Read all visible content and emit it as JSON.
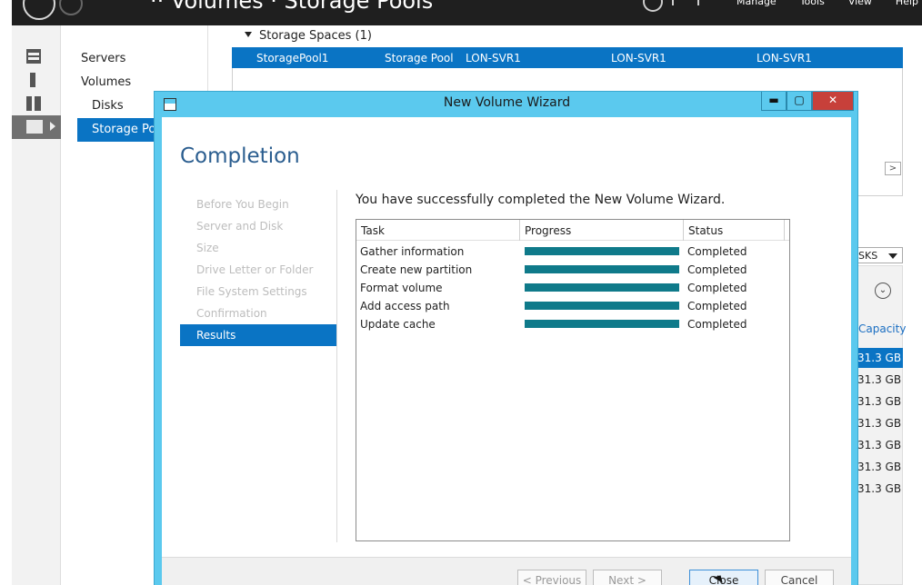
{
  "header": {
    "breadcrumb": "·· Volumes · Storage Pools",
    "menu": [
      "Manage",
      "Tools",
      "View",
      "Help"
    ]
  },
  "sidebar": {
    "items": [
      "Servers",
      "Volumes",
      "Disks",
      "Storage Pools"
    ]
  },
  "storage_spaces": {
    "header": "Storage Spaces (1)",
    "row": {
      "name": "StoragePool1",
      "type": "Storage Pool",
      "managed_by": "LON-SVR1",
      "available_to": "LON-SVR1",
      "read_write_server": "LON-SVR1"
    }
  },
  "disks_panel": {
    "dropdown_label": "SKS",
    "capacity_header": "Capacity",
    "capacities": [
      "31.3 GB",
      "31.3 GB",
      "31.3 GB",
      "31.3 GB",
      "31.3 GB",
      "31.3 GB",
      "31.3 GB"
    ]
  },
  "wizard": {
    "title": "New Volume Wizard",
    "heading": "Completion",
    "steps": [
      "Before You Begin",
      "Server and Disk",
      "Size",
      "Drive Letter or Folder",
      "File System Settings",
      "Confirmation",
      "Results"
    ],
    "current_step": "Results",
    "message": "You have successfully completed the New Volume Wizard.",
    "columns": [
      "Task",
      "Progress",
      "Status"
    ],
    "tasks": [
      {
        "task": "Gather information",
        "progress": 100,
        "status": "Completed"
      },
      {
        "task": "Create new partition",
        "progress": 100,
        "status": "Completed"
      },
      {
        "task": "Format volume",
        "progress": 100,
        "status": "Completed"
      },
      {
        "task": "Add access path",
        "progress": 100,
        "status": "Completed"
      },
      {
        "task": "Update cache",
        "progress": 100,
        "status": "Completed"
      }
    ],
    "buttons": {
      "previous": "< Previous",
      "next": "Next >",
      "close": "Close",
      "cancel": "Cancel"
    },
    "window_buttons": {
      "minimize": "▬",
      "maximize": "▢",
      "close": "✕"
    }
  },
  "colors": {
    "selection": "#0a74c4",
    "wizard_frame": "#5bc9ee",
    "progress_fill": "#0f7a8a",
    "close_button": "#c7403a"
  }
}
